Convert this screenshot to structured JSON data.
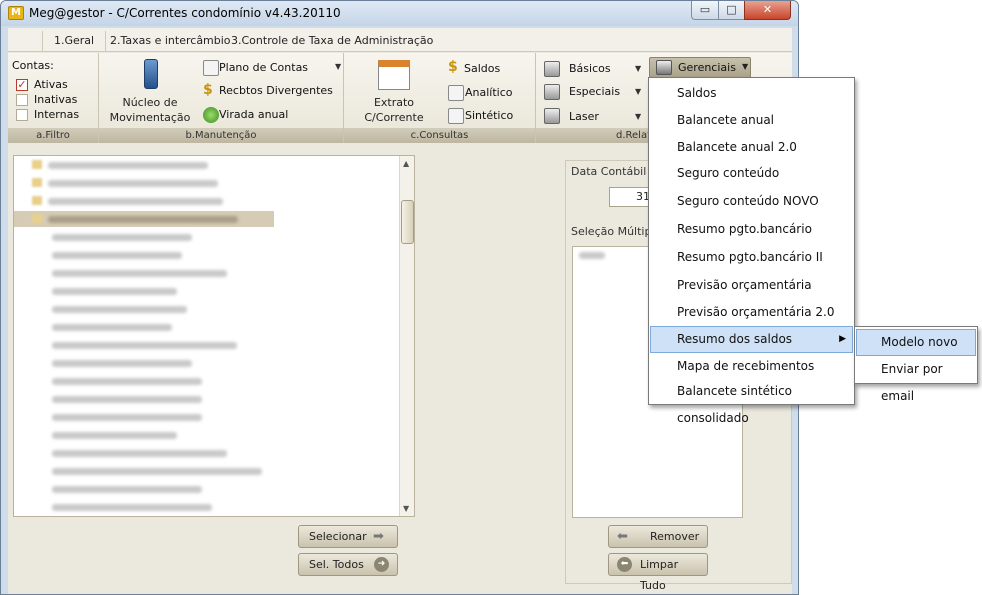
{
  "window": {
    "title": "Meg@gestor - C/Correntes condomínio v4.43.20110",
    "app_icon": "M",
    "controls": {
      "minimize": "▭",
      "maximize": "□",
      "close": "✕"
    }
  },
  "tabs": [
    "1.Geral",
    "2.Taxas e intercâmbio",
    "3.Controle de Taxa de Administração"
  ],
  "ribbon": {
    "filtro": {
      "label": "a.Filtro",
      "contas_label": "Contas:",
      "checks": [
        {
          "label": "Ativas",
          "checked": true
        },
        {
          "label": "Inativas",
          "checked": false
        },
        {
          "label": "Internas",
          "checked": false
        }
      ]
    },
    "manutencao": {
      "label": "b.Manutenção",
      "nucleo": "Núcleo de\nMovimentação",
      "plano": "Plano de Contas",
      "recbtos": "Recbtos Divergentes",
      "virada": "Virada anual"
    },
    "consultas": {
      "label": "c.Consultas",
      "extrato": "Extrato\nC/Corrente",
      "saldos": "Saldos",
      "analitico": "Analítico",
      "sintetico": "Sintético"
    },
    "relatorios": {
      "label": "d.Relat",
      "basicos": "Básicos",
      "especiais": "Especiais",
      "laser": "Laser",
      "gerenciais": "Gerenciais"
    }
  },
  "right": {
    "data_label": "Data Contábil",
    "date_value": "31/",
    "selecao_label": "Seleção Múltipla"
  },
  "buttons": {
    "selecionar": "Selecionar",
    "sel_todos": "Sel. Todos",
    "remover": "Remover",
    "limpar": "Limpar Tudo"
  },
  "menu": {
    "items": [
      "Saldos",
      "Balancete anual",
      "Balancete anual 2.0",
      "Seguro conteúdo",
      "Seguro conteúdo NOVO",
      "Resumo pgto.bancário",
      "Resumo pgto.bancário II",
      "Previsão orçamentária",
      "Previsão orçamentária 2.0",
      "Resumo dos saldos",
      "Mapa de recebimentos",
      "Balancete sintético consolidado"
    ],
    "hover_index": 9,
    "submenu": [
      "Modelo novo",
      "Enviar por email"
    ]
  },
  "colors": {
    "accent": "#cfe1f6",
    "ribbon_label": "#bdb6a0",
    "check": "#c62a16"
  }
}
